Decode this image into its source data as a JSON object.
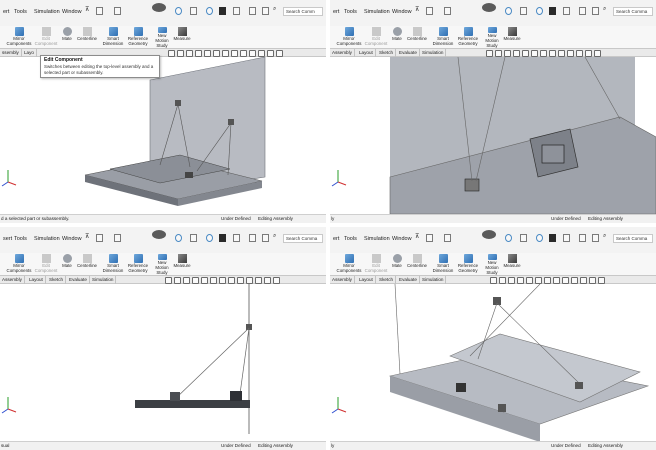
{
  "panes": [
    {
      "menus": [
        "ert",
        "Tools",
        "Simulation",
        "Window"
      ],
      "search": "Search Comm",
      "ribbon": [
        {
          "label": "Mirror\nComponents",
          "disabled": false
        },
        {
          "label": "Edit\nComponent",
          "disabled": true
        },
        {
          "label": "Mate",
          "disabled": false
        },
        {
          "label": "Centerline",
          "disabled": false
        },
        {
          "label": "Smart\nDimension",
          "disabled": false
        },
        {
          "label": "Reference\nGeometry",
          "disabled": false
        },
        {
          "label": "New\nMotion\nStudy",
          "disabled": false
        },
        {
          "label": "Measure",
          "disabled": false
        }
      ],
      "tabs": [
        "ssembly",
        "Layo"
      ],
      "status": {
        "left": "d a selected part or subassembly.",
        "middle": "Under Defined",
        "right": "Editing Assembly"
      }
    },
    {
      "menus": [
        "ert",
        "Tools",
        "Simulation",
        "Window"
      ],
      "search": "Search Comma",
      "ribbon": [
        {
          "label": "Mirror\nComponents",
          "disabled": false
        },
        {
          "label": "Edit\nComponent",
          "disabled": true
        },
        {
          "label": "Mate",
          "disabled": false
        },
        {
          "label": "Centerline",
          "disabled": false
        },
        {
          "label": "Smart\nDimension",
          "disabled": false
        },
        {
          "label": "Reference\nGeometry",
          "disabled": false
        },
        {
          "label": "New\nMotion\nStudy",
          "disabled": false
        },
        {
          "label": "Measure",
          "disabled": false
        }
      ],
      "tabs": [
        "Assembly",
        "Layout",
        "Sketch",
        "Evaluate",
        "Simulation"
      ],
      "status": {
        "left": "ly",
        "middle": "Under Defined",
        "right": "Editing Assembly"
      }
    },
    {
      "menus": [
        "sert",
        "Tools",
        "Simulation",
        "Window"
      ],
      "search": "Search Comma",
      "ribbon": [
        {
          "label": "Mirror\nComponents",
          "disabled": false
        },
        {
          "label": "Edit\nComponent",
          "disabled": true
        },
        {
          "label": "Mate",
          "disabled": false
        },
        {
          "label": "Centerline",
          "disabled": false
        },
        {
          "label": "Smart\nDimension",
          "disabled": false
        },
        {
          "label": "Reference\nGeometry",
          "disabled": false
        },
        {
          "label": "New\nMotion\nStudy",
          "disabled": false
        },
        {
          "label": "Measure",
          "disabled": false
        }
      ],
      "tabs": [
        "Assembly",
        "Layout",
        "Sketch",
        "Evaluate",
        "Simulation"
      ],
      "status": {
        "left": "sual",
        "middle": "Under Defined",
        "right": "Editing Assembly"
      }
    },
    {
      "menus": [
        "ert",
        "Tools",
        "Simulation",
        "Window"
      ],
      "search": "Search Comma",
      "ribbon": [
        {
          "label": "Mirror\nComponents",
          "disabled": false
        },
        {
          "label": "Edit\nComponent",
          "disabled": true
        },
        {
          "label": "Mate",
          "disabled": false
        },
        {
          "label": "Centerline",
          "disabled": false
        },
        {
          "label": "Smart\nDimension",
          "disabled": false
        },
        {
          "label": "Reference\nGeometry",
          "disabled": false
        },
        {
          "label": "New\nMotion\nStudy",
          "disabled": false
        },
        {
          "label": "Measure",
          "disabled": false
        }
      ],
      "tabs": [
        "Assembly",
        "Layout",
        "Sketch",
        "Evaluate",
        "Simulation"
      ],
      "status": {
        "left": "ly",
        "middle": "Under Defined",
        "right": "Editing Assembly"
      }
    }
  ],
  "tooltip": {
    "title": "Edit Component",
    "body": "Switches between editing the top-level assembly and a selected part or subassembly."
  },
  "icons": [
    "mirror-components-icon",
    "edit-component-icon",
    "mate-icon",
    "centerline-icon",
    "smart-dimension-icon",
    "reference-geometry-icon",
    "motion-study-icon",
    "measure-icon",
    "search-icon"
  ],
  "colors": {
    "model_gray": "#8a8e96",
    "selected_blue": "#2f6fb3",
    "toolbar_bg": "#f3f3f3"
  }
}
